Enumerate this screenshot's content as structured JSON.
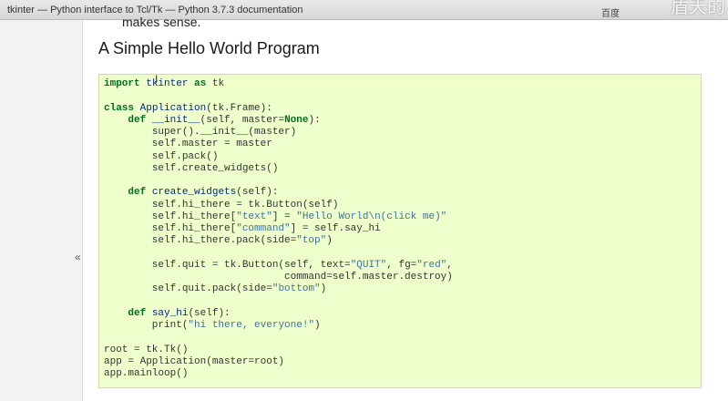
{
  "browser": {
    "tab_title": "tkinter — Python interface to Tcl/Tk — Python 3.7.3 documentation",
    "right_label": "百度",
    "watermark": "盾天的"
  },
  "sidebar": {
    "collapse_glyph": "«"
  },
  "page": {
    "prev_text": "makes sense.",
    "heading": "A Simple Hello World Program"
  },
  "code": [
    "import tkinter as tk",
    "",
    "class Application(tk.Frame):",
    "    def __init__(self, master=None):",
    "        super().__init__(master)",
    "        self.master = master",
    "        self.pack()",
    "        self.create_widgets()",
    "",
    "    def create_widgets(self):",
    "        self.hi_there = tk.Button(self)",
    "        self.hi_there[\"text\"] = \"Hello World\\n(click me)\"",
    "        self.hi_there[\"command\"] = self.say_hi",
    "        self.hi_there.pack(side=\"top\")",
    "",
    "        self.quit = tk.Button(self, text=\"QUIT\", fg=\"red\",",
    "                              command=self.master.destroy)",
    "        self.quit.pack(side=\"bottom\")",
    "",
    "    def say_hi(self):",
    "        print(\"hi there, everyone!\")",
    "",
    "root = tk.Tk()",
    "app = Application(master=root)",
    "app.mainloop()"
  ],
  "colors": {
    "code_background": "#eeffcc",
    "keyword": "#007020",
    "function_name": "#06287e",
    "string": "#4070a0"
  }
}
